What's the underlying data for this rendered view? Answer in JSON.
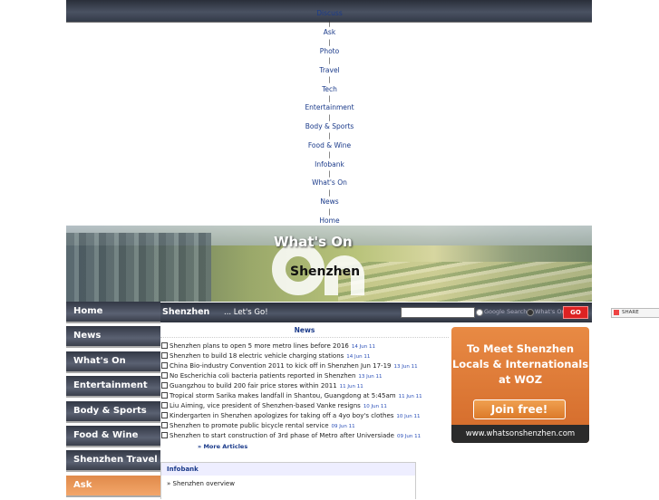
{
  "top_nav": [
    "Discuss",
    "Ask",
    "Photo",
    "Travel",
    "Tech",
    "Entertainment",
    "Body & Sports",
    "Food & Wine",
    "Infobank",
    "What's On",
    "News",
    "Home"
  ],
  "banner": {
    "title": "What's On",
    "city": "Shenzhen"
  },
  "side_nav": [
    "Home",
    "News",
    "What's On",
    "Entertainment",
    "Body & Sports",
    "Food & Wine",
    "Shenzhen Travel",
    "Ask"
  ],
  "search": {
    "city": "Shenzhen",
    "tagline": "... Let's Go!",
    "value": "",
    "options": [
      "Google Search",
      "What's On"
    ],
    "go_label": "GO"
  },
  "share_label": "SHARE",
  "news": {
    "header": "News",
    "items": [
      {
        "text": "Shenzhen plans to open 5 more metro lines before 2016",
        "date": "14 Jun 11"
      },
      {
        "text": "Shenzhen to build 18 electric vehicle charging stations",
        "date": "14 Jun 11"
      },
      {
        "text": "China Bio-industry Convention 2011 to kick off in Shenzhen Jun 17-19",
        "date": "13 Jun 11"
      },
      {
        "text": "No Escherichia coli bacteria patients reported in Shenzhen",
        "date": "13 Jun 11"
      },
      {
        "text": "Guangzhou to build 200 fair price stores within 2011",
        "date": "11 Jun 11"
      },
      {
        "text": "Tropical storm Sarika makes landfall in Shantou, Guangdong at 5:45am",
        "date": "11 Jun 11"
      },
      {
        "text": "Liu Aiming, vice president of Shenzhen-based Vanke resigns",
        "date": "10 Jun 11"
      },
      {
        "text": "Kindergarten in Shenzhen apologizes for taking off a 4yo boy's clothes",
        "date": "10 Jun 11"
      },
      {
        "text": "Shenzhen to promote public bicycle rental service",
        "date": "09 Jun 11"
      },
      {
        "text": "Shenzhen to start construction of 3rd phase of Metro after Universiade",
        "date": "09 Jun 11"
      }
    ],
    "more": "» More Articles"
  },
  "ad": {
    "lines": [
      "To Meet Shenzhen",
      "Locals & Internationals",
      "at WOZ"
    ],
    "cta": "Join free!",
    "url": "www.whatsonshenzhen.com"
  },
  "infobank": {
    "header": "Infobank",
    "items": [
      "» Shenzhen overview"
    ]
  }
}
